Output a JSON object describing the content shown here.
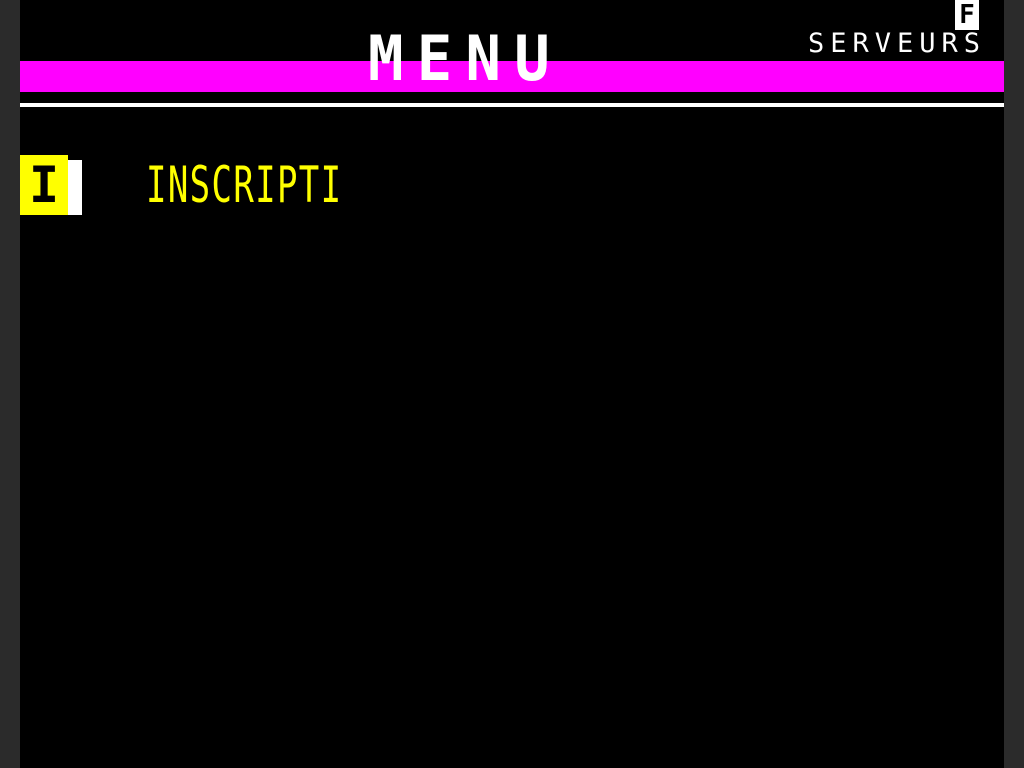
{
  "header": {
    "title": "MENU",
    "service_tag": "F",
    "service_name": "SERVEURS"
  },
  "menu": {
    "items": [
      {
        "key": "I",
        "label": "INSCRIPTI"
      }
    ]
  },
  "colors": {
    "background": "#000000",
    "title_bar": "#ff00ff",
    "accent": "#ffff00",
    "text": "#ffffff"
  }
}
